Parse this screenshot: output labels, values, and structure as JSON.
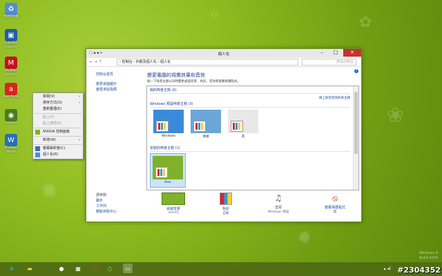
{
  "desktop": {
    "icons": [
      {
        "label": "資源回收筒",
        "icon": "recycle-bin-icon",
        "color": "#4f8fcf"
      },
      {
        "label": "Intel(R) Graphics",
        "icon": "intel-graphics-icon",
        "color": "#1f5fa8"
      },
      {
        "label": "McAfee Internet",
        "icon": "mcafee-icon",
        "color": "#c8101e"
      },
      {
        "label": "Acer Portal",
        "icon": "acer-portal-icon",
        "color": "#d9251d"
      },
      {
        "label": "Explorer",
        "icon": "explorer-icon",
        "color": "#4a7d1e"
      },
      {
        "label": "Windows Media",
        "icon": "windows-media-icon",
        "color": "#2a6fb5"
      }
    ]
  },
  "context_menu": {
    "items": [
      {
        "label": "檢視(V)",
        "submenu": true,
        "disabled": false
      },
      {
        "label": "排序方式(O)",
        "submenu": true,
        "disabled": false
      },
      {
        "label": "重新整理(E)",
        "submenu": false,
        "disabled": false
      },
      {
        "label": "貼上(P)",
        "submenu": false,
        "disabled": true
      },
      {
        "label": "貼上捷徑(S)",
        "submenu": false,
        "disabled": true
      },
      {
        "label": "NVIDIA 控制面板",
        "submenu": false,
        "disabled": false
      },
      {
        "label": "新增(W)",
        "submenu": true,
        "disabled": false
      },
      {
        "label": "螢幕解析度(C)",
        "submenu": false,
        "disabled": false
      },
      {
        "label": "個人化(R)",
        "submenu": false,
        "disabled": false
      }
    ]
  },
  "window": {
    "title": "個人化",
    "address": {
      "path": "› 控制台 › 外觀及個人化 › 個人化",
      "search_placeholder": "搜尋控制台"
    },
    "left_nav": {
      "home": "控制台首頁",
      "links": [
        "變更桌面圖示",
        "變更滑鼠指標"
      ],
      "see_also": [
        "請參閱",
        "顯示",
        "工作列",
        "輕鬆存取中心"
      ]
    },
    "heading": "變更電腦的視覺效果和音效",
    "description": "按一下佈景主題以同時變更桌面背景、色彩、音效和螢幕保護程式。",
    "sections": {
      "my_themes": "我的佈景主題 (0)",
      "get_more": "線上取得其他佈景主題",
      "windows_default": "Windows 預設佈景主題 (3)",
      "installed": "安裝的佈景主題 (1)"
    },
    "themes": [
      {
        "name": "Windows",
        "bg": "#3b8ad9"
      },
      {
        "name": "地球",
        "bg": "#6aa7d8"
      },
      {
        "name": "花",
        "bg": "#e8e8e8"
      }
    ],
    "installed_theme": {
      "name": "Acer",
      "bg": "#7fb22a"
    },
    "tiles": [
      {
        "title": "桌面背景",
        "sub": "acer01"
      },
      {
        "title": "色彩",
        "sub": "自動"
      },
      {
        "title": "音效",
        "sub": "Windows 預設"
      },
      {
        "title": "螢幕保護程式",
        "sub": "無"
      }
    ]
  },
  "watermark": {
    "line1": "Windows 8",
    "line2": "Build 9200"
  },
  "stamp": "#2304352"
}
